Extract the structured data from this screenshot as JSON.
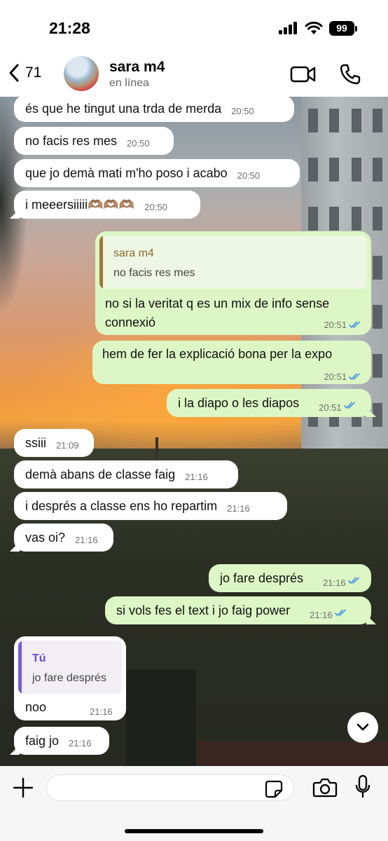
{
  "status_bar": {
    "time": "21:28",
    "battery": "99"
  },
  "header": {
    "back_count": "71",
    "contact_name": "sara m4",
    "presence": "en línea"
  },
  "messages": [
    {
      "dir": "in",
      "text": "és que he tingut una trda de merda",
      "time": "20:50"
    },
    {
      "dir": "in",
      "text": "no facis res mes",
      "time": "20:50"
    },
    {
      "dir": "in",
      "text": "que jo demà mati m'ho poso i acabo",
      "time": "20:50"
    },
    {
      "dir": "in",
      "text": "i meeersiiiii🫶🏽🫶🏽🫶🏽",
      "time": "20:50"
    },
    {
      "dir": "out",
      "quote_author": "sara m4",
      "quote_text": "no facis res mes",
      "text_line1": "no si la veritat q es un mix de info sense",
      "text_line2": "connexió",
      "time": "20:51"
    },
    {
      "dir": "out",
      "text": "hem de fer la explicació bona per la expo",
      "time": "20:51"
    },
    {
      "dir": "out",
      "text": "i la diapo o les diapos",
      "time": "20:51"
    },
    {
      "dir": "in",
      "text": "ssiii",
      "time": "21:09"
    },
    {
      "dir": "in",
      "text": "demà abans de classe faig",
      "time": "21:16"
    },
    {
      "dir": "in",
      "text": "i després a classe ens ho repartim",
      "time": "21:16"
    },
    {
      "dir": "in",
      "text": "vas oi?",
      "time": "21:16"
    },
    {
      "dir": "out",
      "text": "jo fare després",
      "time": "21:16"
    },
    {
      "dir": "out",
      "text": "si vols fes el text i jo faig power",
      "time": "21:16"
    },
    {
      "dir": "in",
      "quote_author": "Tú",
      "quote_text": "jo fare després",
      "text": "noo",
      "time": "21:16"
    },
    {
      "dir": "in",
      "text": "faig jo",
      "time": "21:16"
    }
  ],
  "input": {
    "placeholder": ""
  },
  "icons": {
    "back": "chevron-left-icon",
    "video": "video-camera-icon",
    "phone": "phone-icon",
    "plus": "plus-icon",
    "sticker": "sticker-icon",
    "camera": "camera-icon",
    "mic": "microphone-icon",
    "scroll": "chevron-down-icon"
  },
  "colors": {
    "incoming_bubble": "#ffffff",
    "outgoing_bubble": "#dcf7c5",
    "read_ticks": "#3b8fe6",
    "quote_bar_contact": "#9a7a3a",
    "quote_name_contact": "#8a6a2e",
    "quote_bar_self": "#7b5bd6",
    "quote_name_self": "#6a4fcf"
  }
}
